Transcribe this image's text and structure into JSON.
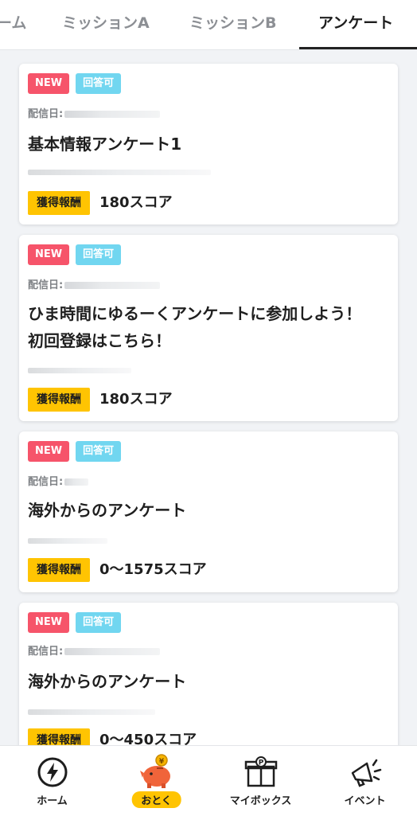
{
  "tabs": [
    {
      "label": "ホーム",
      "shown": "ーム"
    },
    {
      "label": "ミッションA"
    },
    {
      "label": "ミッションB"
    },
    {
      "label": "アンケート"
    }
  ],
  "cards": [
    {
      "badge_new": "NEW",
      "badge_status": "回答可",
      "date_label": "配信日:",
      "title": "基本情報アンケート1",
      "reward_label": "獲得報酬",
      "reward_value": "180スコア"
    },
    {
      "badge_new": "NEW",
      "badge_status": "回答可",
      "date_label": "配信日:",
      "title": "ひま時間にゆるーくアンケートに参加しよう！初回登録はこちら！",
      "reward_label": "獲得報酬",
      "reward_value": "180スコア"
    },
    {
      "badge_new": "NEW",
      "badge_status": "回答可",
      "date_label": "配信日:",
      "title": "海外からのアンケート",
      "reward_label": "獲得報酬",
      "reward_value": "0〜1575スコア"
    },
    {
      "badge_new": "NEW",
      "badge_status": "回答可",
      "date_label": "配信日:",
      "title": "海外からのアンケート",
      "reward_label": "獲得報酬",
      "reward_value": "0〜450スコア"
    }
  ],
  "bottom_nav": [
    {
      "label": "ホーム",
      "icon": "lightning-icon"
    },
    {
      "label": "おとく",
      "icon": "piggy-bank-icon",
      "active": true
    },
    {
      "label": "マイボックス",
      "icon": "gift-box-icon"
    },
    {
      "label": "イベント",
      "icon": "megaphone-icon"
    }
  ],
  "colors": {
    "new_badge": "#f6546a",
    "status_badge": "#71d6f0",
    "reward_label": "#ffc402",
    "active_tab": "#1e1e1e",
    "inactive_tab": "#8c8f94"
  }
}
